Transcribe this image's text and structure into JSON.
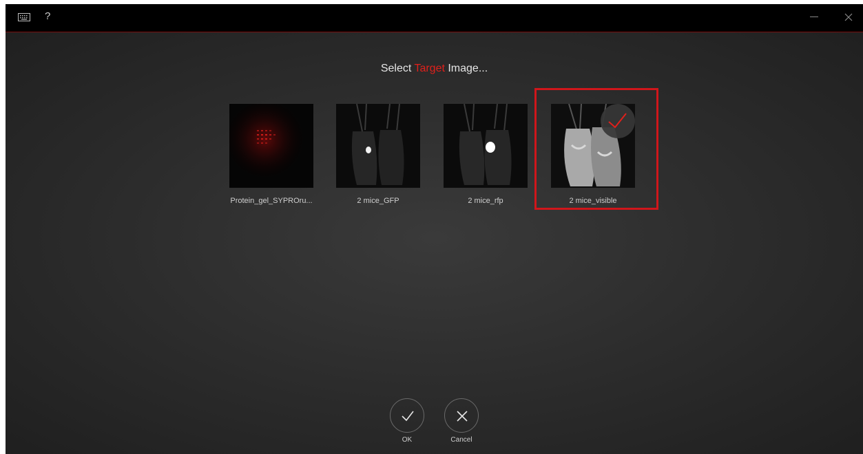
{
  "titlebar": {
    "keyboard_icon": "keyboard-icon",
    "help_label": "?",
    "minimize_icon": "minimize-icon",
    "close_icon": "close-icon"
  },
  "heading": {
    "prefix": "Select",
    "accent": "Target",
    "suffix": "Image..."
  },
  "colors": {
    "accent": "#e0201b",
    "selection_frame": "#d0161b",
    "titlebar_bg": "#000000",
    "text": "#cfcfcf"
  },
  "images": [
    {
      "label": "Protein_gel_SYPROru...",
      "selected": false
    },
    {
      "label": "2 mice_GFP",
      "selected": false
    },
    {
      "label": "2 mice_rfp",
      "selected": false
    },
    {
      "label": "2 mice_visible",
      "selected": true
    }
  ],
  "actions": {
    "ok_label": "OK",
    "cancel_label": "Cancel"
  }
}
